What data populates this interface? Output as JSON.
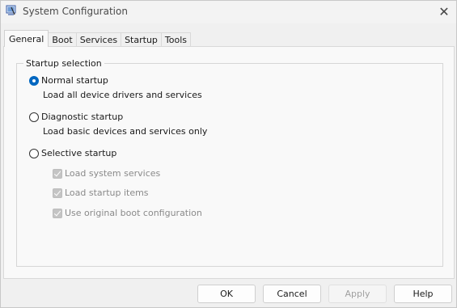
{
  "window": {
    "title": "System Configuration",
    "close_glyph": "✕",
    "app_icon": "msconfig-icon"
  },
  "tabs": [
    {
      "label": "General",
      "active": true
    },
    {
      "label": "Boot",
      "active": false
    },
    {
      "label": "Services",
      "active": false
    },
    {
      "label": "Startup",
      "active": false
    },
    {
      "label": "Tools",
      "active": false
    }
  ],
  "startup_selection": {
    "legend": "Startup selection",
    "options": [
      {
        "label": "Normal startup",
        "description": "Load all device drivers and services",
        "selected": true
      },
      {
        "label": "Diagnostic startup",
        "description": "Load basic devices and services only",
        "selected": false
      },
      {
        "label": "Selective startup",
        "description": "",
        "selected": false
      }
    ],
    "selective_items": [
      {
        "label": "Load system services",
        "checked": true,
        "enabled": false
      },
      {
        "label": "Load startup items",
        "checked": true,
        "enabled": false
      },
      {
        "label": "Use original boot configuration",
        "checked": true,
        "enabled": false
      }
    ]
  },
  "buttons": {
    "ok": "OK",
    "cancel": "Cancel",
    "apply": "Apply",
    "help": "Help"
  },
  "colors": {
    "accent": "#0067c0",
    "disabled_text": "#8a8a8a"
  }
}
